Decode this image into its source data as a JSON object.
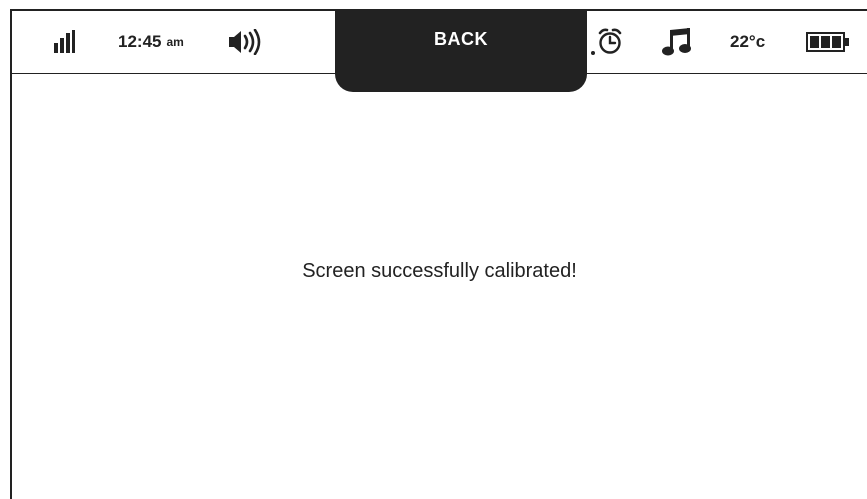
{
  "status_bar": {
    "time": "12:45",
    "ampm": "am",
    "temperature": "22°c",
    "back_label": "BACK",
    "icons": [
      "signal-icon",
      "volume-icon",
      "alarm-icon",
      "music-icon",
      "battery-icon"
    ]
  },
  "main": {
    "message": "Screen successfully calibrated!"
  },
  "colors": {
    "ink": "#222222",
    "background": "#ffffff"
  }
}
